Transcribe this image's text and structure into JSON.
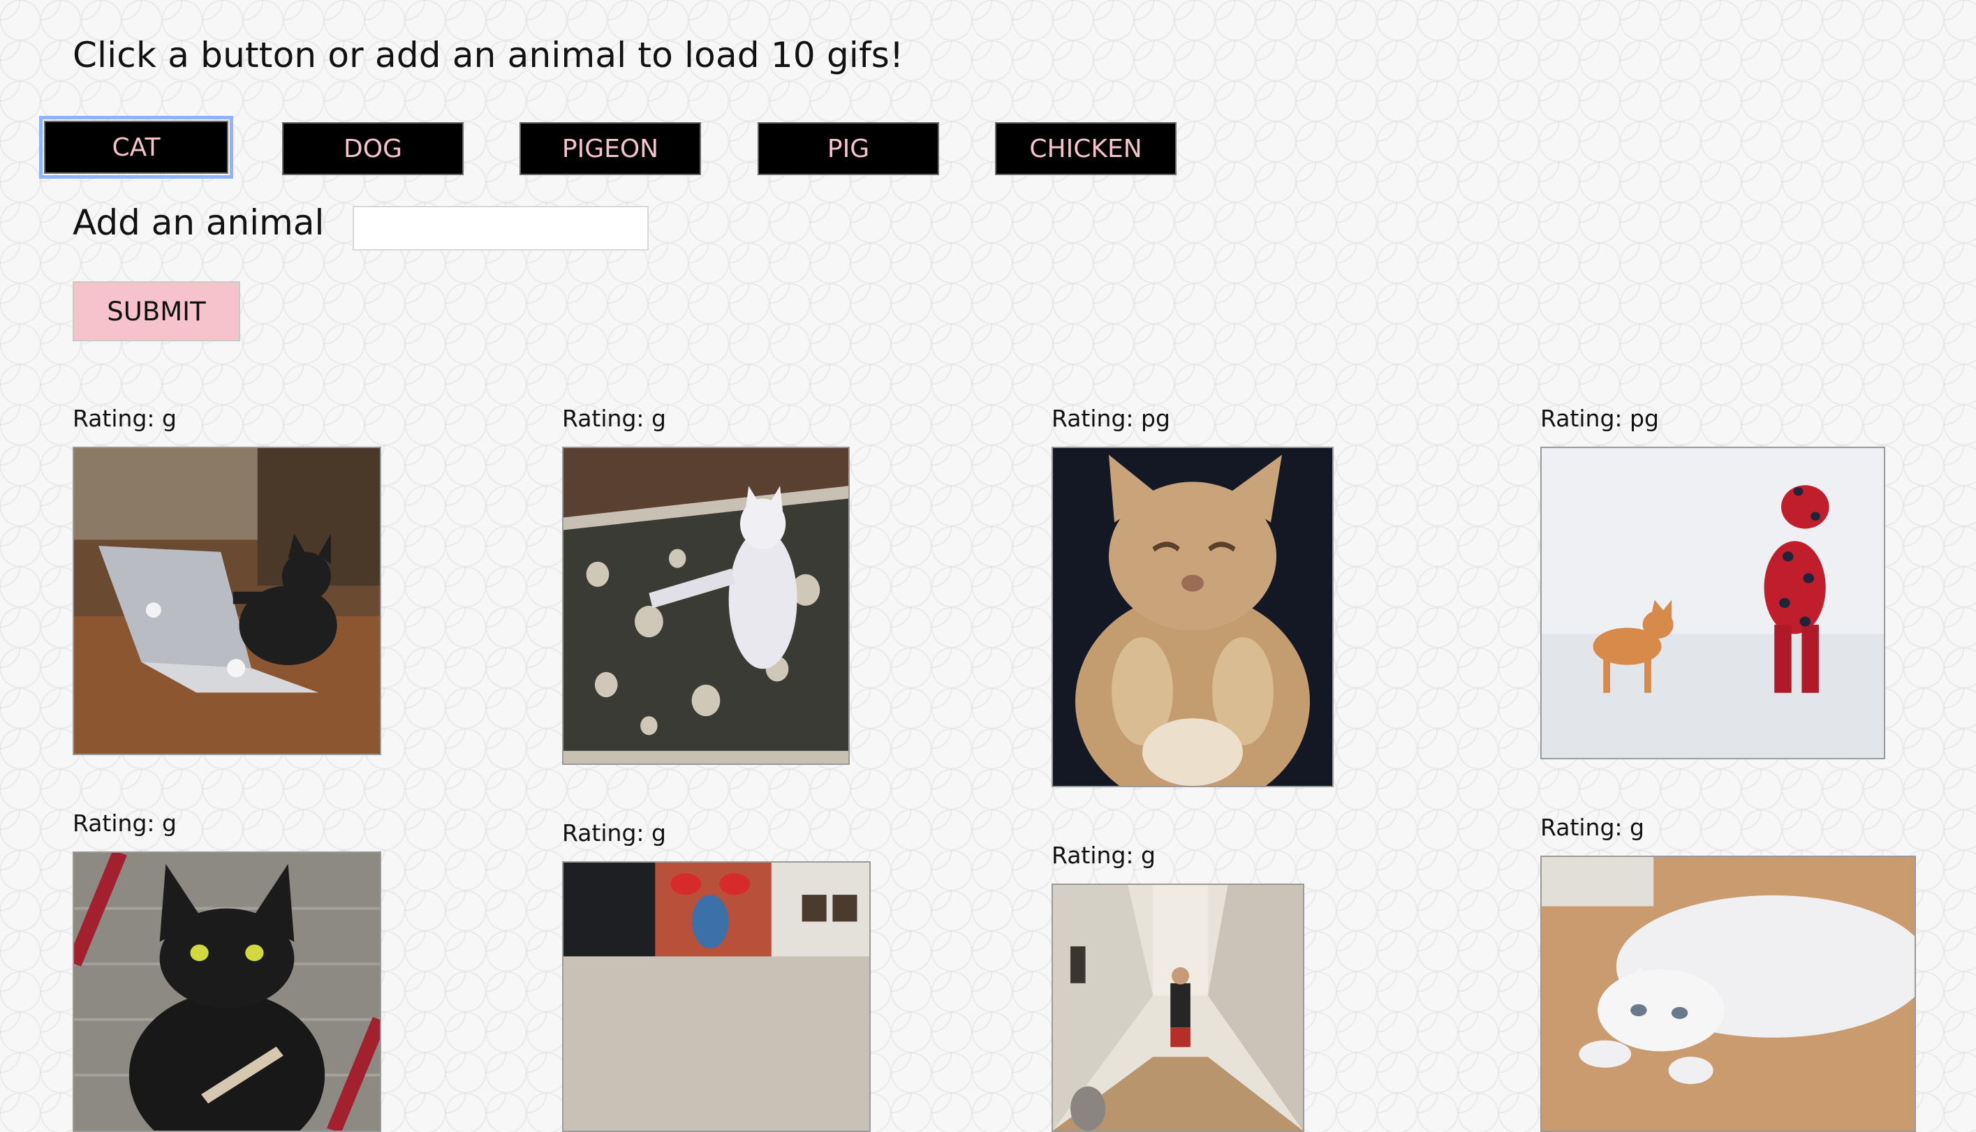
{
  "prompt": "Click a button or add an animal to load 10 gifs!",
  "animal_buttons": [
    "CAT",
    "DOG",
    "PIGEON",
    "PIG",
    "CHICKEN"
  ],
  "add_animal": {
    "label": "Add an animal",
    "value": "",
    "submit_label": "SUBMIT"
  },
  "gifs": [
    {
      "rating": "Rating: g",
      "subject": "cat typing on laptop"
    },
    {
      "rating": "Rating: g",
      "subject": "white cat standing on rug"
    },
    {
      "rating": "Rating: pg",
      "subject": "kitten paws up"
    },
    {
      "rating": "Rating: pg",
      "subject": "cat following child in snow"
    },
    {
      "rating": "Rating: g",
      "subject": "black cat with nail file"
    },
    {
      "rating": "Rating: g",
      "subject": "room with vase painting"
    },
    {
      "rating": "Rating: g",
      "subject": "man and cat in hallway"
    },
    {
      "rating": "Rating: g",
      "subject": "white cat lying on floor"
    }
  ],
  "colors": {
    "button_bg": "#000000",
    "button_text": "#f6c2cb",
    "submit_bg": "#f6c2cb",
    "focus_ring": "#8fb4ff"
  }
}
